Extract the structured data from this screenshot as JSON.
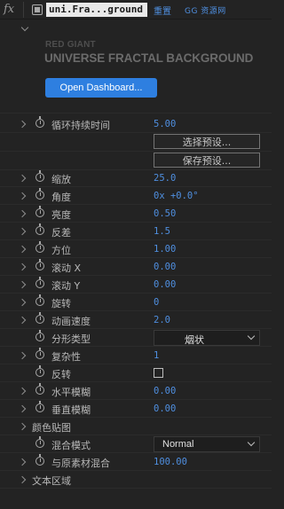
{
  "header": {
    "fx_label": "fx",
    "effect_name": "uni.Fra...ground",
    "reset_label": "重置",
    "watermark": "GG 资源网"
  },
  "plugin": {
    "vendor": "RED GIANT",
    "title": "UNIVERSE FRACTAL BACKGROUND",
    "dashboard_button": "Open Dashboard..."
  },
  "params": {
    "loop_duration": {
      "label": "循环持续时间",
      "value": "5.00"
    },
    "select_preset": "选择预设...",
    "save_preset": "保存预设...",
    "scale": {
      "label": "缩放",
      "value": "25.0"
    },
    "angle": {
      "label": "角度",
      "value": "0x +0.0°"
    },
    "brightness": {
      "label": "亮度",
      "value": "0.50"
    },
    "contrast": {
      "label": "反差",
      "value": "1.5"
    },
    "direction": {
      "label": "方位",
      "value": "1.00"
    },
    "scroll_x": {
      "label": "滚动 X",
      "value": "0.00"
    },
    "scroll_y": {
      "label": "滚动 Y",
      "value": "0.00"
    },
    "rotation": {
      "label": "旋转",
      "value": "0"
    },
    "anim_speed": {
      "label": "动画速度",
      "value": "2.0"
    },
    "fractal_type": {
      "label": "分形类型",
      "selected": "烟状"
    },
    "complexity": {
      "label": "复杂性",
      "value": "1"
    },
    "invert": {
      "label": "反转",
      "checked": false
    },
    "h_blur": {
      "label": "水平模糊",
      "value": "0.00"
    },
    "v_blur": {
      "label": "垂直模糊",
      "value": "0.00"
    },
    "color_map": {
      "label": "颜色贴图"
    },
    "blend_mode": {
      "label": "混合模式",
      "selected": "Normal"
    },
    "blend_original": {
      "label": "与原素材混合",
      "value": "100.00"
    },
    "text_area": {
      "label": "文本区域"
    }
  },
  "colors": {
    "background": "#232323",
    "value_blue": "#4f8fe0",
    "button_blue": "#2e7fe0"
  }
}
